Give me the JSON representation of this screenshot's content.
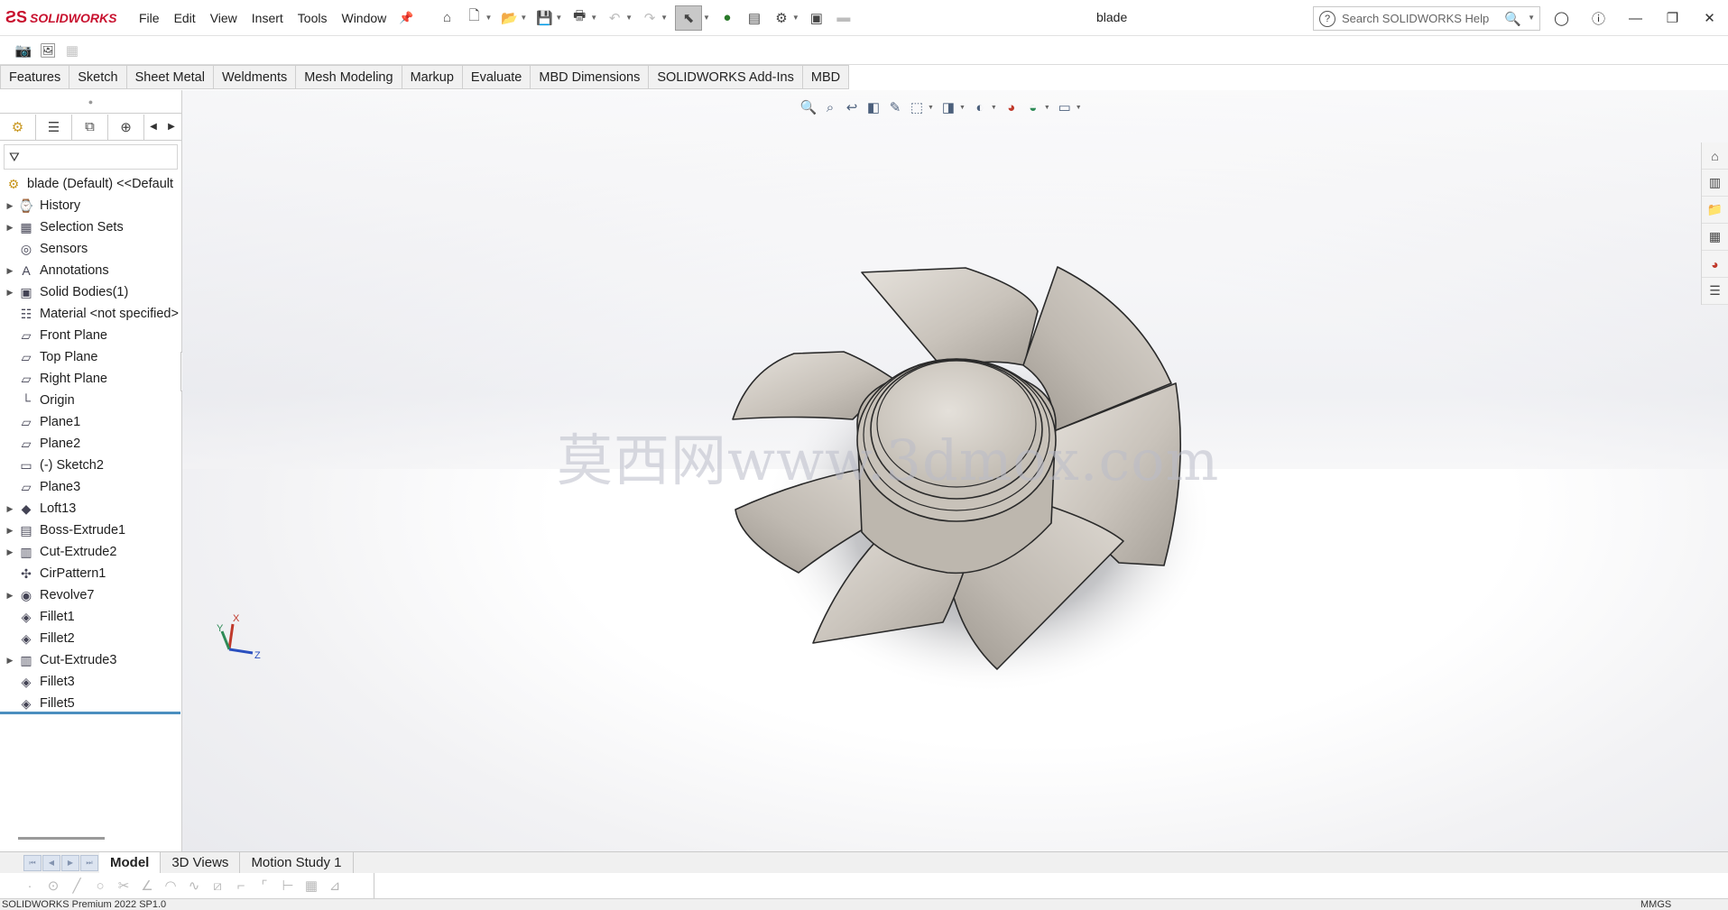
{
  "app": {
    "brand": "SOLIDWORKS",
    "document_title": "blade"
  },
  "menu": [
    "File",
    "Edit",
    "View",
    "Insert",
    "Tools",
    "Window"
  ],
  "search": {
    "placeholder": "Search SOLIDWORKS Help"
  },
  "command_tabs": [
    "Features",
    "Sketch",
    "Sheet Metal",
    "Weldments",
    "Mesh Modeling",
    "Markup",
    "Evaluate",
    "MBD Dimensions",
    "SOLIDWORKS Add-Ins",
    "MBD"
  ],
  "feature_tree": {
    "items": [
      {
        "label": "blade (Default) <<Default",
        "icon": "part-icon",
        "expandable": false,
        "root": true
      },
      {
        "label": "History",
        "icon": "history-icon",
        "expandable": true
      },
      {
        "label": "Selection Sets",
        "icon": "selection-sets-icon",
        "expandable": true
      },
      {
        "label": "Sensors",
        "icon": "sensors-icon",
        "expandable": false
      },
      {
        "label": "Annotations",
        "icon": "annotations-icon",
        "expandable": true
      },
      {
        "label": "Solid Bodies(1)",
        "icon": "solid-bodies-icon",
        "expandable": true
      },
      {
        "label": "Material <not specified>",
        "icon": "material-icon",
        "expandable": false
      },
      {
        "label": "Front Plane",
        "icon": "plane-icon",
        "expandable": false
      },
      {
        "label": "Top Plane",
        "icon": "plane-icon",
        "expandable": false
      },
      {
        "label": "Right Plane",
        "icon": "plane-icon",
        "expandable": false
      },
      {
        "label": "Origin",
        "icon": "origin-icon",
        "expandable": false
      },
      {
        "label": "Plane1",
        "icon": "plane-icon",
        "expandable": false
      },
      {
        "label": "Plane2",
        "icon": "plane-icon",
        "expandable": false
      },
      {
        "label": "(-) Sketch2",
        "icon": "sketch-icon",
        "expandable": false
      },
      {
        "label": "Plane3",
        "icon": "plane-icon",
        "expandable": false
      },
      {
        "label": "Loft13",
        "icon": "loft-icon",
        "expandable": true
      },
      {
        "label": "Boss-Extrude1",
        "icon": "extrude-icon",
        "expandable": true
      },
      {
        "label": "Cut-Extrude2",
        "icon": "cut-extrude-icon",
        "expandable": true
      },
      {
        "label": "CirPattern1",
        "icon": "circular-pattern-icon",
        "expandable": false
      },
      {
        "label": "Revolve7",
        "icon": "revolve-icon",
        "expandable": true
      },
      {
        "label": "Fillet1",
        "icon": "fillet-icon",
        "expandable": false
      },
      {
        "label": "Fillet2",
        "icon": "fillet-icon",
        "expandable": false
      },
      {
        "label": "Cut-Extrude3",
        "icon": "cut-extrude-icon",
        "expandable": true
      },
      {
        "label": "Fillet3",
        "icon": "fillet-icon",
        "expandable": false
      },
      {
        "label": "Fillet5",
        "icon": "fillet-icon",
        "expandable": false
      }
    ]
  },
  "viewport": {
    "watermark": "莫西网www.3dmox.com"
  },
  "triad": {
    "x": "X",
    "y": "Y",
    "z": "Z"
  },
  "bottom_tabs": [
    "Model",
    "3D Views",
    "Motion Study 1"
  ],
  "bottom_active_tab": "Model",
  "status": {
    "left": "SOLIDWORKS Premium 2022 SP1.0",
    "right": "MMGS"
  }
}
